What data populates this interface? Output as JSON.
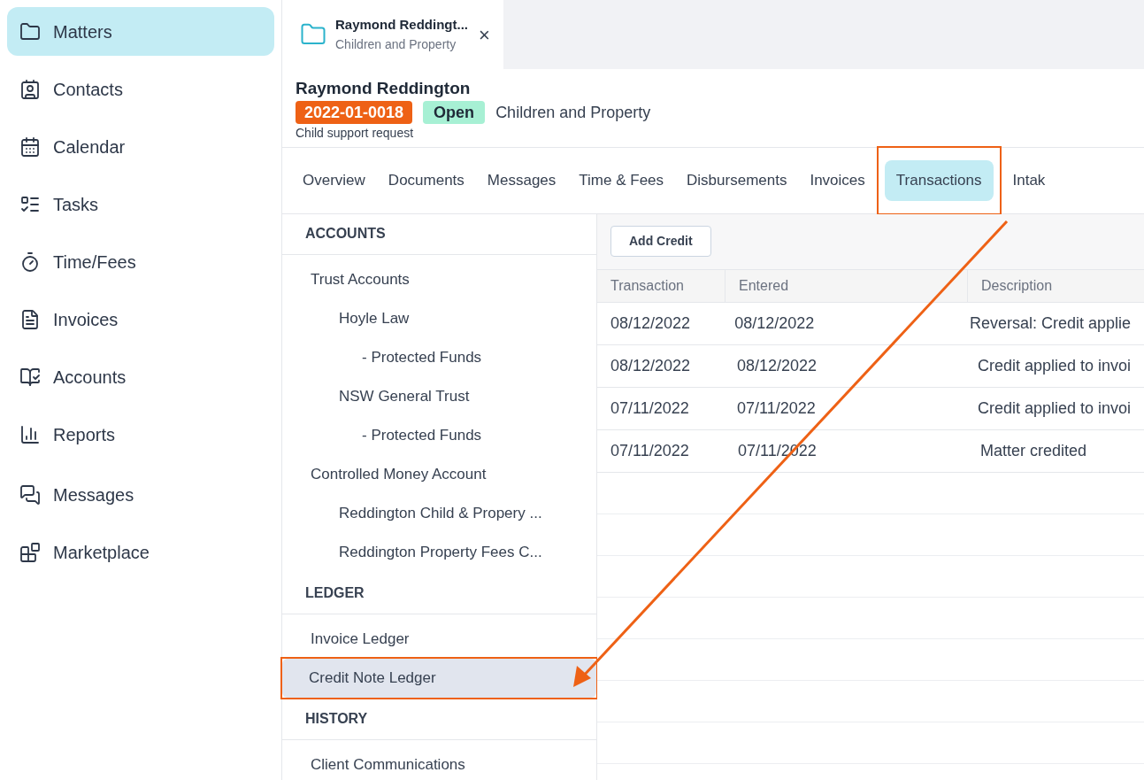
{
  "sidebar": {
    "items": [
      {
        "label": "Matters",
        "selected": true
      },
      {
        "label": "Contacts",
        "selected": false
      },
      {
        "label": "Calendar",
        "selected": false
      },
      {
        "label": "Tasks",
        "selected": false
      },
      {
        "label": "Time/Fees",
        "selected": false
      },
      {
        "label": "Invoices",
        "selected": false
      },
      {
        "label": "Accounts",
        "selected": false
      },
      {
        "label": "Reports",
        "selected": false
      },
      {
        "label": "Messages",
        "selected": false
      },
      {
        "label": "Marketplace",
        "selected": false
      }
    ]
  },
  "open_tab": {
    "title": "Raymond Reddingt...",
    "subtitle": "Children and Property",
    "close": "×"
  },
  "matter": {
    "client": "Raymond Reddington",
    "number": "2022-01-0018",
    "status": "Open",
    "type": "Children and Property",
    "description": "Child support request"
  },
  "tabs": [
    {
      "label": "Overview",
      "selected": false,
      "annotated": false
    },
    {
      "label": "Documents",
      "selected": false,
      "annotated": false
    },
    {
      "label": "Messages",
      "selected": false,
      "annotated": false
    },
    {
      "label": "Time & Fees",
      "selected": false,
      "annotated": false
    },
    {
      "label": "Disbursements",
      "selected": false,
      "annotated": false
    },
    {
      "label": "Invoices",
      "selected": false,
      "annotated": false
    },
    {
      "label": "Transactions",
      "selected": true,
      "annotated": true
    },
    {
      "label": "Intak",
      "selected": false,
      "annotated": false
    }
  ],
  "panel": {
    "sections": [
      {
        "heading": "ACCOUNTS",
        "items": [
          {
            "label": "Trust Accounts",
            "selected": false,
            "annotated": false,
            "children": [
              {
                "label": "Hoyle Law",
                "selected": false,
                "annotated": false,
                "children": [
                  {
                    "label": "- Protected Funds",
                    "selected": false,
                    "annotated": false
                  }
                ]
              },
              {
                "label": "NSW General Trust",
                "selected": false,
                "annotated": false,
                "children": [
                  {
                    "label": "- Protected Funds",
                    "selected": false,
                    "annotated": false
                  }
                ]
              }
            ]
          },
          {
            "label": "Controlled Money Account",
            "selected": false,
            "annotated": false,
            "children": [
              {
                "label": "Reddington Child & Propery ...",
                "selected": false,
                "annotated": false
              },
              {
                "label": "Reddington Property Fees C...",
                "selected": false,
                "annotated": false
              }
            ]
          }
        ]
      },
      {
        "heading": "LEDGER",
        "items": [
          {
            "label": "Invoice Ledger",
            "selected": false,
            "annotated": false
          },
          {
            "label": "Credit Note Ledger",
            "selected": true,
            "annotated": true
          }
        ]
      },
      {
        "heading": "HISTORY",
        "items": [
          {
            "label": "Client Communications",
            "selected": false,
            "annotated": false
          }
        ]
      }
    ]
  },
  "toolbar": {
    "button": "Add Credit"
  },
  "table": {
    "columns": [
      "Transaction",
      "Entered",
      "Description"
    ],
    "rows": [
      [
        "08/12/2022",
        "08/12/2022",
        "Reversal: Credit applie"
      ],
      [
        "08/12/2022",
        "08/12/2022",
        "Credit applied to invoi"
      ],
      [
        "07/11/2022",
        "07/11/2022",
        "Credit applied to invoi"
      ],
      [
        "07/11/2022",
        "07/11/2022",
        "Matter credited"
      ]
    ]
  }
}
